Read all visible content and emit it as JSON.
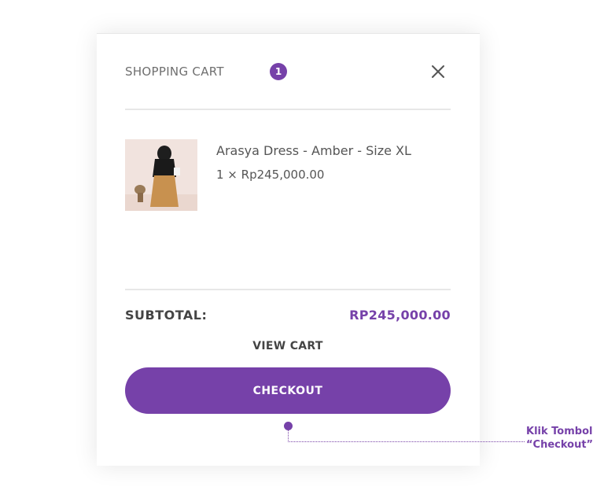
{
  "colors": {
    "accent": "#7641a9",
    "text": "#555555"
  },
  "cart": {
    "title": "SHOPPING CART",
    "count": "1",
    "close_icon": "close-icon"
  },
  "item": {
    "name": "Arasya Dress - Amber - Size XL",
    "quantity_price": "1 × Rp245,000.00",
    "image_icon": "product-thumbnail"
  },
  "summary": {
    "subtotal_label": "SUBTOTAL:",
    "subtotal_value": "RP245,000.00"
  },
  "actions": {
    "view_cart": "VIEW CART",
    "checkout": "CHECKOUT"
  },
  "callout": {
    "line1": "Klik Tombol",
    "line2": "“Checkout”"
  }
}
